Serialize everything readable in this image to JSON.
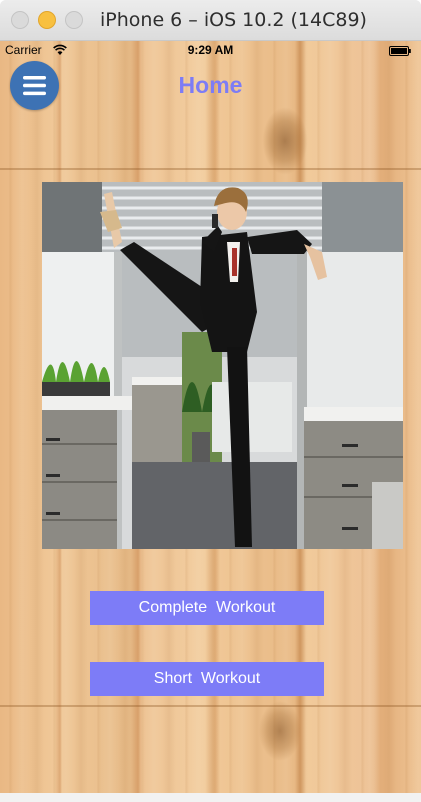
{
  "window": {
    "title": "iPhone 6 – iOS 10.2 (14C89)"
  },
  "status_bar": {
    "carrier": "Carrier",
    "time": "9:29 AM",
    "icons": [
      "wifi-icon",
      "battery-icon"
    ]
  },
  "nav": {
    "title": "Home",
    "menu_icon": "hamburger-menu-icon"
  },
  "hero": {
    "alt": "businesswoman-stretching-office-photo"
  },
  "buttons": {
    "complete_workout": "Complete  Workout",
    "short_workout": "Short  Workout"
  },
  "colors": {
    "accent": "#7d7cf7",
    "menu_button": "#3d72b4",
    "title": "#7d7cf5"
  }
}
